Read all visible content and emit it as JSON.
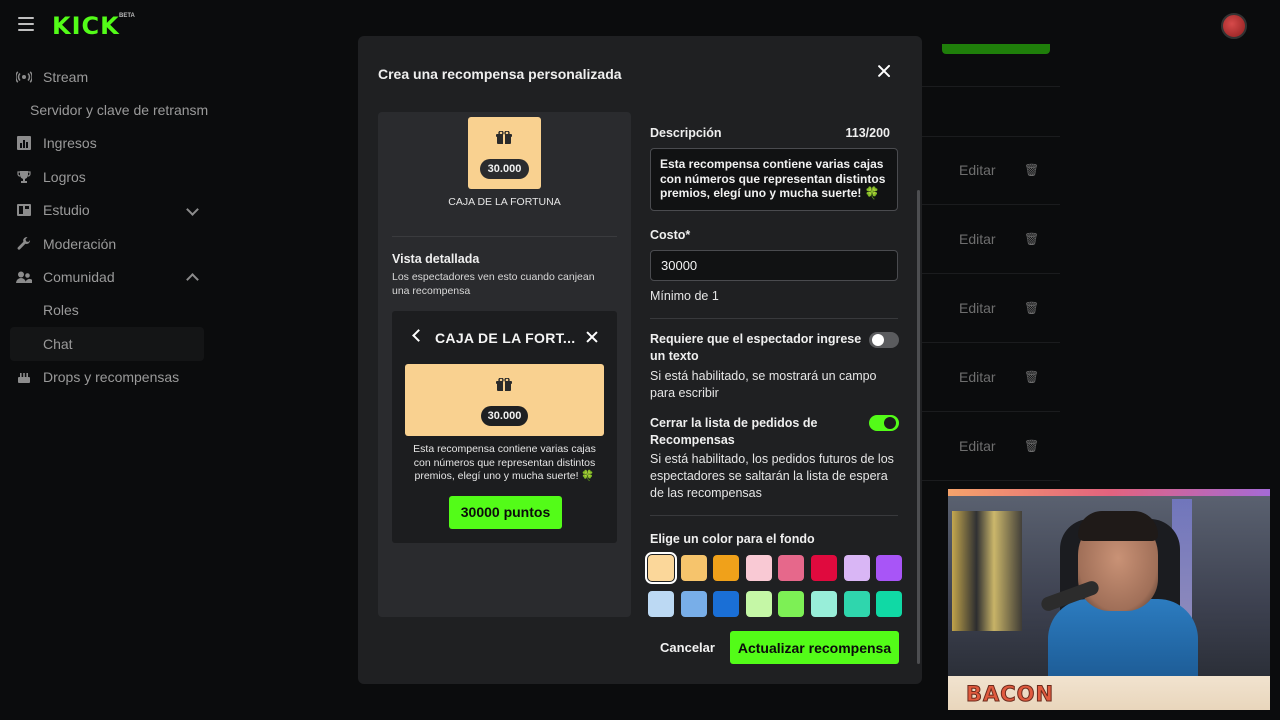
{
  "topbar": {
    "logo": "KICK",
    "logo_badge": "BETA"
  },
  "sidebar": {
    "items": [
      {
        "label": "Stream",
        "icon": "broadcast-icon"
      },
      {
        "label": "Servidor y clave de retransm",
        "icon": ""
      },
      {
        "label": "Ingresos",
        "icon": "chart-icon"
      },
      {
        "label": "Logros",
        "icon": "trophy-icon"
      },
      {
        "label": "Estudio",
        "icon": "studio-icon"
      },
      {
        "label": "Moderación",
        "icon": "wrench-icon"
      },
      {
        "label": "Comunidad",
        "icon": "users-icon"
      },
      {
        "label": "Roles",
        "icon": ""
      },
      {
        "label": "Chat",
        "icon": ""
      },
      {
        "label": "Drops y recompensas",
        "icon": "cake-icon"
      }
    ]
  },
  "background": {
    "edit_label": "Editar"
  },
  "modal": {
    "title": "Crea una recompensa personalizada",
    "preview": {
      "mini_cost": "30.000",
      "mini_name": "CAJA DE LA FORTUNA",
      "heading": "Vista detallada",
      "description": "Los espectadores ven esto cuando canjean una recompensa",
      "detail_title": "CAJA DE LA FORT...",
      "detail_cost": "30.000",
      "detail_text": "Esta recompensa contiene varias cajas con números que representan distintos premios, elegí uno y mucha suerte! 🍀",
      "points_button": "30000 puntos"
    },
    "form": {
      "description_label": "Descripción",
      "description_counter": "113/200",
      "description_value": "Esta recompensa contiene varias cajas con números que representan distintos premios, elegí uno y mucha suerte! 🍀",
      "cost_label": "Costo*",
      "cost_value": "30000",
      "cost_hint": "Mínimo de 1",
      "require_text_label": "Requiere que el espectador ingrese un texto",
      "require_text_hint": "Si está habilitado, se mostrará un campo para escribir",
      "require_text_enabled": false,
      "skip_queue_label": "Cerrar la lista de pedidos de Recompensas",
      "skip_queue_hint": "Si está habilitado, los pedidos futuros de los espectadores se saltarán la lista de espera de las recompensas",
      "skip_queue_enabled": true,
      "color_label": "Elige un color para el fondo",
      "colors": [
        "#fbd79a",
        "#f6c46c",
        "#f0a11a",
        "#f9c9d4",
        "#e6688b",
        "#e00a3e",
        "#d9b6f5",
        "#a855f7",
        "#bcd9f3",
        "#78aee8",
        "#1a6fd6",
        "#c5f7a6",
        "#7df055",
        "#98eed9",
        "#2fd6ad",
        "#10d9a5"
      ],
      "selected_color_index": 0
    },
    "cancel_button": "Cancelar",
    "submit_button": "Actualizar recompensa"
  },
  "webcam": {
    "name": "BACON"
  }
}
